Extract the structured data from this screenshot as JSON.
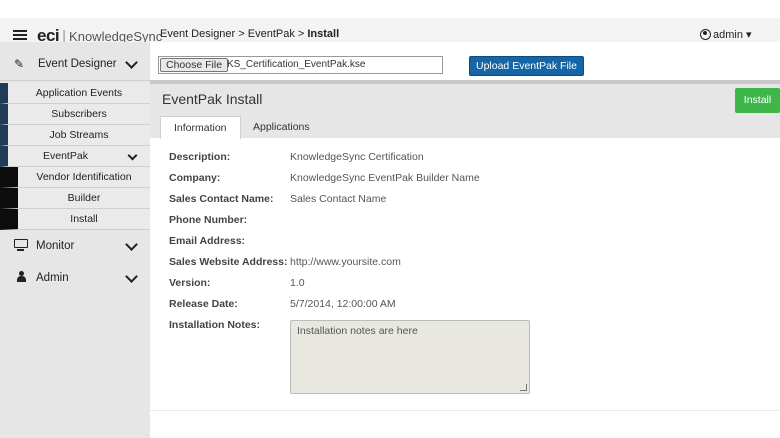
{
  "header": {
    "logo_eci": "eci",
    "logo_product": "KnowledgeSync",
    "breadcrumb_prefix": "Event Designer > EventPak > ",
    "breadcrumb_current": "Install",
    "user": "admin"
  },
  "sidebar": {
    "event_designer": "Event Designer",
    "items": [
      "Application Events",
      "Subscribers",
      "Job Streams"
    ],
    "eventpak": "EventPak",
    "eventpak_items": [
      "Vendor Identification",
      "Builder",
      "Install"
    ],
    "monitor": "Monitor",
    "admin": "Admin"
  },
  "upload": {
    "choose_label": "Choose File",
    "file_name": "KS_Certification_EventPak.kse",
    "upload_label": "Upload EventPak File"
  },
  "panel": {
    "title": "EventPak Install",
    "install_label": "Install",
    "tabs": [
      "Information",
      "Applications"
    ]
  },
  "fields": [
    {
      "label": "Description:",
      "value": "KnowledgeSync Certification"
    },
    {
      "label": "Company:",
      "value": "KnowledgeSync EventPak Builder Name"
    },
    {
      "label": "Sales Contact Name:",
      "value": "Sales Contact Name"
    },
    {
      "label": "Phone Number:",
      "value": ""
    },
    {
      "label": "Email Address:",
      "value": ""
    },
    {
      "label": "Sales Website Address:",
      "value": "http://www.yoursite.com"
    },
    {
      "label": "Version:",
      "value": "1.0"
    },
    {
      "label": "Release Date:",
      "value": "5/7/2014, 12:00:00 AM"
    },
    {
      "label": "Installation Notes:",
      "value": "Installation notes are here"
    }
  ]
}
